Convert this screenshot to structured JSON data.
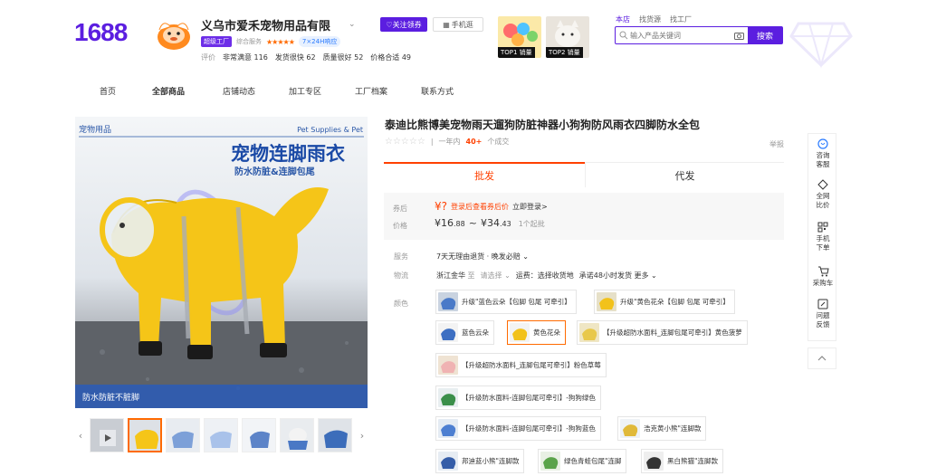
{
  "header": {
    "logo": "1688",
    "shop_name": "义乌市爱禾宠物用品有限",
    "follow_label": "关注领券",
    "mobile_label": "手机逛",
    "badge_factory": "超级工厂",
    "badge_service": "综合服务",
    "stars": "★★★★★",
    "badge_online": "7×24H响应",
    "metrics_label": "评价",
    "metrics": [
      {
        "label": "非常满意",
        "value": "116"
      },
      {
        "label": "发货很快",
        "value": "62"
      },
      {
        "label": "质量很好",
        "value": "52"
      },
      {
        "label": "价格合适",
        "value": "49"
      }
    ],
    "top_items": [
      {
        "tag": "TOP1 销量"
      },
      {
        "tag": "TOP2 销量"
      }
    ],
    "search_tabs": [
      "本店",
      "找货源",
      "找工厂"
    ],
    "search_placeholder": "输入产品关键词",
    "search_button": "搜索"
  },
  "nav": [
    "首页",
    "全部商品",
    "店铺动态",
    "加工专区",
    "工厂档案",
    "联系方式"
  ],
  "gallery": {
    "category_cn": "宠物用品",
    "category_en": "Pet Supplies & Pet",
    "headline": "宠物连脚雨衣",
    "subline": "防水防脏&连脚包尾",
    "footer_caption": "防水防脏不脏脚"
  },
  "product": {
    "title": "泰迪比熊博美宠物雨天遛狗防脏神器小狗狗防风雨衣四脚防水全包",
    "stars": "☆☆☆☆☆",
    "sold_prefix": "一年内",
    "sold_count": "40+",
    "sold_suffix": "个成交",
    "report": "举报",
    "tab_wholesale": "批发",
    "tab_dropship": "代发",
    "coupon_label": "券后",
    "coupon_price": "¥?",
    "coupon_link": "登录后查看券后价",
    "coupon_login": "立即登录>",
    "price_label": "价格",
    "price_low": "¥16",
    "price_low_dec": ".88",
    "price_sep": "~",
    "price_high": "¥34",
    "price_high_dec": ".43",
    "moq": "1个起批",
    "service_label": "服务",
    "service_value": "7天无理由退货 · 晚发必赔 ⌄",
    "logistics_label": "物流",
    "origin": "浙江金华",
    "to": "至",
    "choose": "请选择 ⌄",
    "freight": "运费：选择收货地",
    "promise": "承诺48小时发货 更多 ⌄",
    "color_label": "颜色"
  },
  "colors": [
    {
      "label": "升级\"蓝色云朵【包脚 包尾 可牵引】",
      "swatch": "#c9d3e0",
      "accent": "#4a7ac8"
    },
    {
      "label": "升级\"黄色花朵【包脚 包尾 可牵引】",
      "swatch": "#e6e0c8",
      "accent": "#f2c21b"
    },
    {
      "label": "蓝色云朵",
      "swatch": "#f3f3f3",
      "accent": "#3d6fc2"
    },
    {
      "label": "黄色花朵",
      "swatch": "#f3f3f3",
      "accent": "#f2c21b"
    },
    {
      "label": "【升级超防水面料_连脚包尾可牵引】黄色菠萝",
      "swatch": "#efe6c4",
      "accent": "#e8c84a"
    },
    {
      "label": "【升级超防水面料_连脚包尾可牵引】粉色草莓",
      "swatch": "#efe3d3",
      "accent": "#f0b3b3"
    },
    {
      "label": "【升级防水面料-连脚包尾可牵引】-狗狗绿色",
      "swatch": "#e8eef0",
      "accent": "#3b8f4a"
    },
    {
      "label": "【升级防水面料-连脚包尾可牵引】-狗狗蓝色",
      "swatch": "#e4ebf3",
      "accent": "#4d7fd1"
    },
    {
      "label": "浩克黄小熊\"连脚款",
      "swatch": "#eef2f6",
      "accent": "#e0b93a"
    },
    {
      "label": "邦迪蓝小熊\"连脚款",
      "swatch": "#e6ecf3",
      "accent": "#355da8"
    },
    {
      "label": "绿色青蛙包尾\"连脚",
      "swatch": "#e8f0e4",
      "accent": "#5aa34a"
    },
    {
      "label": "黑白熊猫\"连脚款",
      "swatch": "#eeeeee",
      "accent": "#333333"
    }
  ],
  "sidebar": [
    {
      "label": "咨询\n客服",
      "icon": "chat-icon"
    },
    {
      "label": "全网\n比价",
      "icon": "compare-icon"
    },
    {
      "label": "手机\n下单",
      "icon": "qr-icon"
    },
    {
      "label": "采购车",
      "icon": "cart-icon"
    },
    {
      "label": "问题\n反馈",
      "icon": "feedback-icon"
    }
  ],
  "theme": {
    "brand": "#5b1ee0",
    "accent": "#ff4000",
    "orange": "#ff6a00"
  }
}
